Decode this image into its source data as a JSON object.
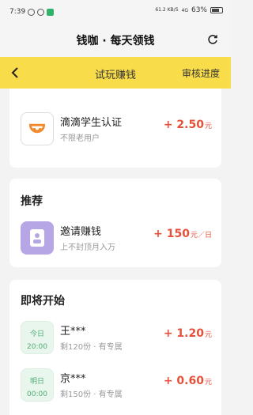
{
  "status_bar": {
    "time": "7:39",
    "net_speed": "61.2\nKB/S",
    "signal": "4G",
    "battery": "63%"
  },
  "title_bar": {
    "title": "钱咖 · 每天领钱",
    "refresh_icon": "refresh-icon"
  },
  "tab_bar": {
    "back_icon": "chevron-left-icon",
    "title": "试玩赚钱",
    "right_link": "审核进度",
    "accent_color": "#f9dc4a"
  },
  "tasks": [
    {
      "icon": "didi-logo-icon",
      "name": "滴滴学生认证",
      "sub": "不限老用户",
      "amount": "+ 2.50",
      "unit": "元"
    }
  ],
  "recommend": {
    "title": "推荐",
    "items": [
      {
        "icon": "invite-icon",
        "name": "邀请赚钱",
        "sub": "上不封顶月入万",
        "amount": "+ 150",
        "unit": "元／日"
      }
    ]
  },
  "upcoming": {
    "title": "即将开始",
    "items": [
      {
        "day": "今日",
        "time": "20:00",
        "name": "王***",
        "sub": "剩120份 · 有专属",
        "amount": "+ 1.20",
        "unit": "元"
      },
      {
        "day": "明日",
        "time": "00:00",
        "name": "京***",
        "sub": "剩150份 · 有专属",
        "amount": "+ 0.60",
        "unit": "元"
      }
    ]
  },
  "colors": {
    "amount": "#e5513a",
    "time_tile": "#4fae73"
  }
}
